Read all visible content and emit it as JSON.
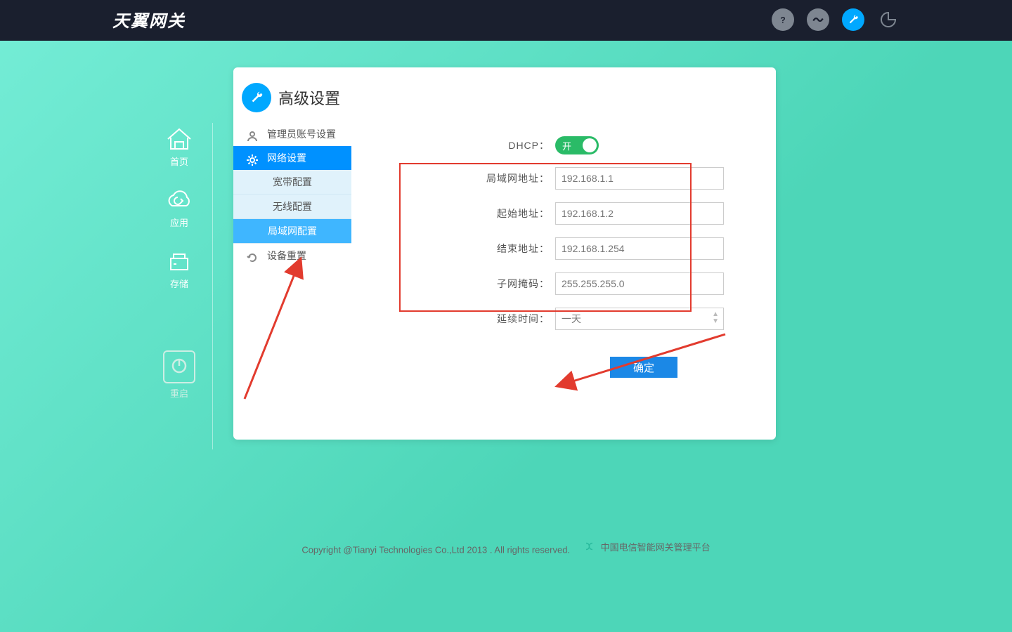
{
  "logo_text": "天翼网关",
  "sidenav": {
    "home": "首页",
    "app": "应用",
    "storage": "存储",
    "reboot": "重启"
  },
  "panel": {
    "title": "高级设置",
    "menu": {
      "admin": "管理员账号设置",
      "network": "网络设置",
      "sub_broadband": "宽带配置",
      "sub_wireless": "无线配置",
      "sub_lan": "局域网配置",
      "reset": "设备重置"
    },
    "form": {
      "dhcp_label": "DHCP：",
      "dhcp_toggle": "开",
      "lan_ip_label": "局域网地址：",
      "lan_ip_value": "192.168.1.1",
      "start_label": "起始地址：",
      "start_value": "192.168.1.2",
      "end_label": "结束地址：",
      "end_value": "192.168.1.254",
      "mask_label": "子网掩码：",
      "mask_value": "255.255.255.0",
      "lease_label": "延续时间：",
      "lease_value": "一天",
      "submit": "确定"
    }
  },
  "footer": {
    "copyright": "Copyright @Tianyi Technologies Co.,Ltd 2013 . All rights reserved.",
    "platform": "中国电信智能网关管理平台"
  }
}
